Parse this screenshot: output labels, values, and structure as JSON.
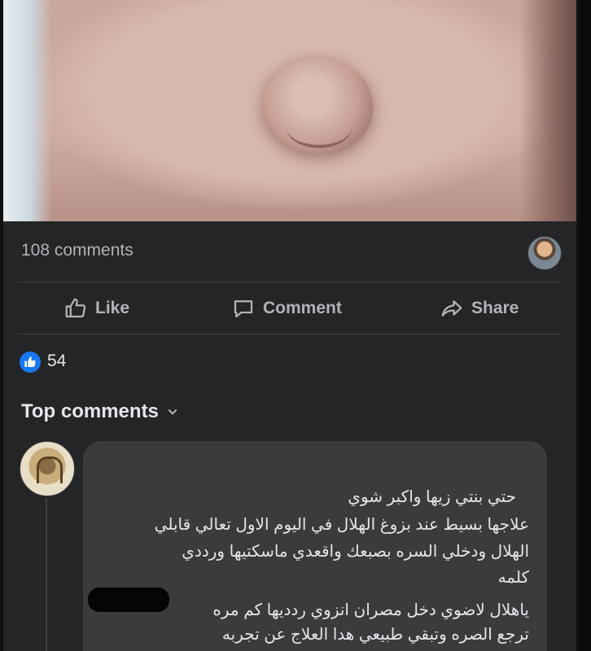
{
  "post": {
    "comments_count": "108 comments",
    "like_count": "54"
  },
  "actions": {
    "like": "Like",
    "comment": "Comment",
    "share": "Share"
  },
  "top_comments": {
    "label": "Top comments"
  },
  "comment": {
    "lines": [
      "حتي بنتي زيها واكبر شوي",
      "علاجها  بسيط عند بزوغ الهلال في اليوم الاول تعالي قابلي",
      "الهلال ودخلي السره بصبعك واقعدي ماسكتيها  ورددي",
      "كلمه",
      "ياهلال لاضوي دخل مصران انزوي ردديها كم مره",
      "ترجع الصره وتبقي طبيعي هدا العلاج عن تجربه"
    ]
  },
  "icons": {
    "like": "thumbs-up-icon",
    "comment": "speech-bubble-icon",
    "share": "share-arrow-icon",
    "reaction": "like-reaction-icon",
    "dropdown": "chevron-down-icon"
  },
  "colors": {
    "background": "#242526",
    "bubble": "#3a3b3c",
    "text_primary": "#e4e6eb",
    "text_secondary": "#b0b3b8",
    "like_blue": "#1877f2"
  }
}
